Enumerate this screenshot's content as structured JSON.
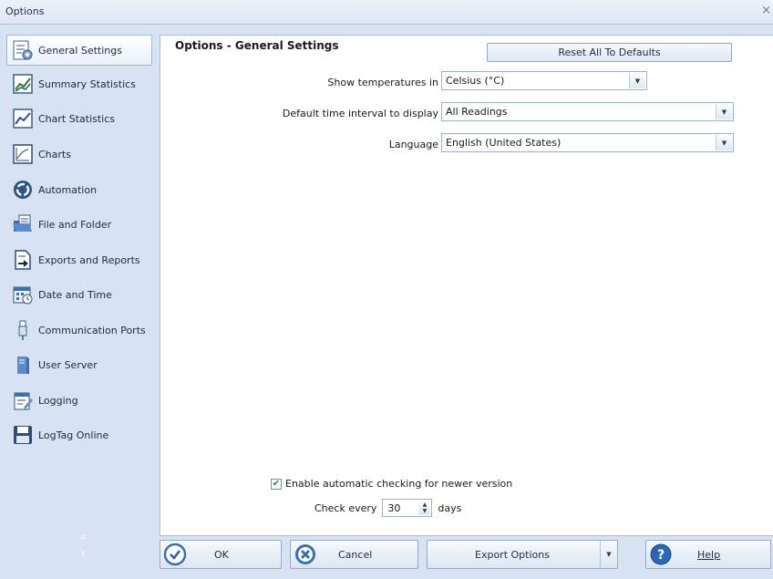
{
  "window": {
    "title": "Options",
    "close_glyph": "×"
  },
  "sidebar": {
    "items": [
      {
        "label": "General Settings",
        "icon": "general-settings-icon",
        "selected": true
      },
      {
        "label": "Summary Statistics",
        "icon": "summary-statistics-icon"
      },
      {
        "label": "Chart Statistics",
        "icon": "chart-statistics-icon"
      },
      {
        "label": "Charts",
        "icon": "charts-icon"
      },
      {
        "label": "Automation",
        "icon": "automation-icon"
      },
      {
        "label": "File and Folder",
        "icon": "folder-icon"
      },
      {
        "label": "Exports and Reports",
        "icon": "export-icon"
      },
      {
        "label": "Date and Time",
        "icon": "calendar-clock-icon"
      },
      {
        "label": "Communication Ports",
        "icon": "usb-port-icon"
      },
      {
        "label": "User Server",
        "icon": "server-icon"
      },
      {
        "label": "Logging",
        "icon": "log-book-icon"
      },
      {
        "label": "LogTag Online",
        "icon": "cloud-save-icon"
      }
    ],
    "scroll_up_glyph": "▲",
    "scroll_down_glyph": "▼"
  },
  "panel": {
    "title": "Options - General Settings",
    "reset_button": "Reset All To Defaults",
    "fields": [
      {
        "label": "Show temperatures in",
        "value": "Celsius (°C)"
      },
      {
        "label": "Default time interval to display",
        "value": "All Readings"
      },
      {
        "label": "Language",
        "value": "English (United States)"
      }
    ],
    "auto_check": {
      "label": "Enable automatic checking for newer version",
      "checked": true,
      "check_glyph": "✔"
    },
    "check_every": {
      "label": "Check every",
      "value": "30",
      "unit": "days"
    }
  },
  "footer": {
    "ok": "OK",
    "cancel": "Cancel",
    "export": "Export Options",
    "help": "Help"
  },
  "colors": {
    "accent": "#2f5f9e",
    "ok_circle": "#3a6fb0",
    "cancel_circle": "#3a6fb0",
    "help_circle": "#2d66b3"
  }
}
